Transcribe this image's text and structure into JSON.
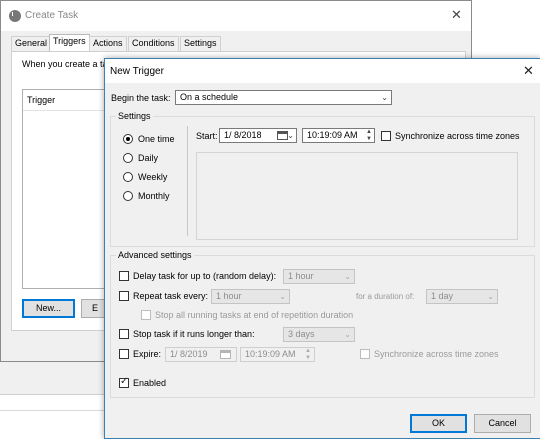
{
  "background": {
    "labels": [
      "",
      ""
    ]
  },
  "create_task": {
    "title": "Create Task",
    "tabs": [
      "General",
      "Triggers",
      "Actions",
      "Conditions",
      "Settings"
    ],
    "description": "When you create a ta",
    "list_header": "Trigger",
    "new_button": "New...",
    "edit_button_partial": "E"
  },
  "new_trigger": {
    "title": "New Trigger",
    "begin_label": "Begin the task:",
    "begin_value": "On a schedule",
    "settings_group": "Settings",
    "radios": [
      "One time",
      "Daily",
      "Weekly",
      "Monthly"
    ],
    "selected_radio": "One time",
    "start_label": "Start:",
    "start_date": "1/  8/2018",
    "start_time": "10:19:09 AM",
    "sync_label": "Synchronize across time zones",
    "advanced_group": "Advanced settings",
    "delay_label": "Delay task for up to (random delay):",
    "delay_value": "1 hour",
    "repeat_label": "Repeat task every:",
    "repeat_value": "1 hour",
    "duration_label": "for a duration of:",
    "duration_value": "1 day",
    "stop_running_label": "Stop all running tasks at end of repetition duration",
    "stop_longer_label": "Stop task if it runs longer than:",
    "stop_longer_value": "3 days",
    "expire_label": "Expire:",
    "expire_date": "1/  8/2019",
    "expire_time": "10:19:09 AM",
    "expire_sync_label": "Synchronize across time zones",
    "enabled_label": "Enabled",
    "enabled_checked": true,
    "ok_button": "OK",
    "cancel_button": "Cancel"
  }
}
